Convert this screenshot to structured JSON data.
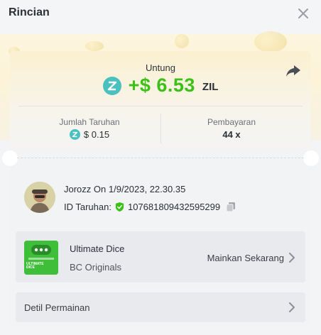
{
  "header": {
    "title": "Rincian"
  },
  "profit": {
    "label": "Untung",
    "amount": "+$ 6.53",
    "currency": "ZIL",
    "color": "#3bc117"
  },
  "stats": {
    "bet_amount_label": "Jumlah Taruhan",
    "bet_amount_value": "$ 0.15",
    "payout_label": "Pembayaran",
    "payout_value": "44 x"
  },
  "user": {
    "name": "Jorozz",
    "on_text": "On 1/9/2023, 22.30.35",
    "bet_id_label": "ID Taruhan:",
    "bet_id": "107681809432595299"
  },
  "game": {
    "name": "Ultimate Dice",
    "provider": "BC Originals",
    "play_label": "Mainkan Sekarang",
    "thumb_text": "ULTIMATE DICE"
  },
  "details": {
    "label": "Detil Permainan"
  },
  "colors": {
    "zil": "#49c1bf",
    "verified": "#3bc117"
  },
  "icons": [
    "close-icon",
    "share-icon",
    "zil-coin-icon",
    "verified-shield-icon",
    "copy-icon",
    "chevron-right-icon"
  ]
}
